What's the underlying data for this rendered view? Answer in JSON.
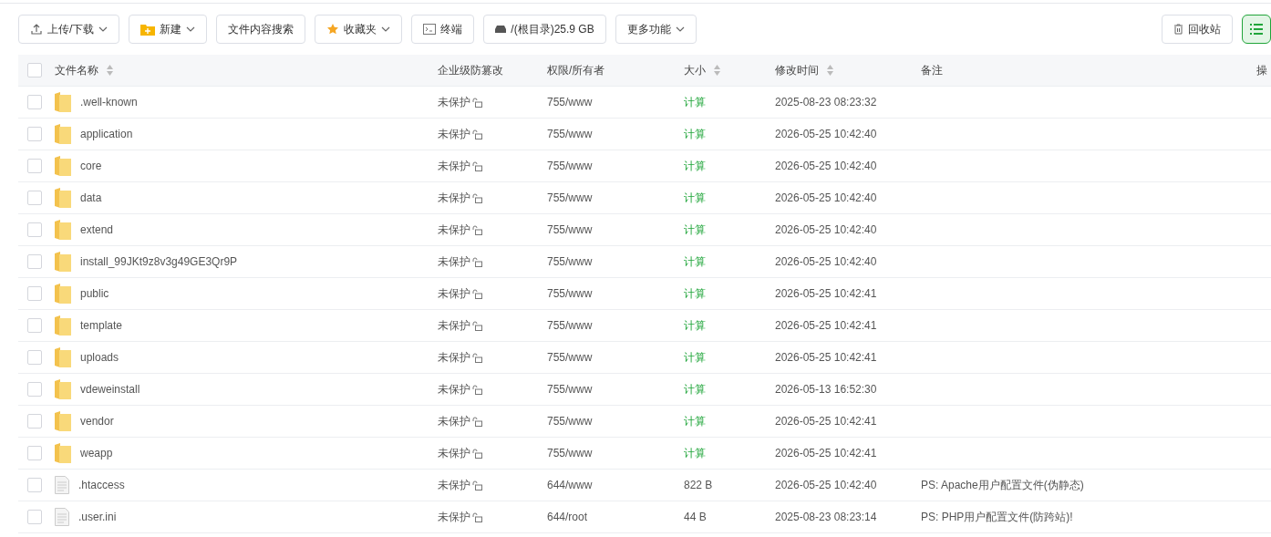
{
  "toolbar": {
    "left": [
      {
        "label": "上传/下载",
        "kind": "upload",
        "dropdown": true
      },
      {
        "label": "新建",
        "kind": "create",
        "dropdown": true
      },
      {
        "label": "文件内容搜索",
        "kind": "plain",
        "dropdown": false
      },
      {
        "label": "收藏夹",
        "kind": "favorites",
        "dropdown": true
      },
      {
        "label": "终端",
        "kind": "terminal",
        "dropdown": false
      },
      {
        "label": "/(根目录)25.9 GB",
        "kind": "disk",
        "dropdown": false
      },
      {
        "label": "更多功能",
        "kind": "plain",
        "dropdown": true
      }
    ],
    "recycle": {
      "label": "回收站"
    },
    "list_view": {
      "selected": true
    }
  },
  "table": {
    "all_checked": false,
    "columns": [
      {
        "label": "文件名称",
        "sortable": true
      },
      {
        "label": "企业级防篡改",
        "sortable": false
      },
      {
        "label": "权限/所有者",
        "sortable": false
      },
      {
        "label": "大小",
        "sortable": true
      },
      {
        "label": "修改时间",
        "sortable": true
      },
      {
        "label": "备注",
        "sortable": false
      },
      {
        "label": "操",
        "sortable": false
      }
    ],
    "rows": [
      {
        "kind": "folder",
        "checked": false,
        "name": ".well-known",
        "protect": "未保护",
        "perm": "755/www",
        "size": "计算",
        "mtime": "2025-08-23 08:23:32"
      },
      {
        "kind": "folder",
        "checked": false,
        "name": "application",
        "protect": "未保护",
        "perm": "755/www",
        "size": "计算",
        "mtime": "2026-05-25 10:42:40"
      },
      {
        "kind": "folder",
        "checked": false,
        "name": "core",
        "protect": "未保护",
        "perm": "755/www",
        "size": "计算",
        "mtime": "2026-05-25 10:42:40"
      },
      {
        "kind": "folder",
        "checked": false,
        "name": "data",
        "protect": "未保护",
        "perm": "755/www",
        "size": "计算",
        "mtime": "2026-05-25 10:42:40"
      },
      {
        "kind": "folder",
        "checked": false,
        "name": "extend",
        "protect": "未保护",
        "perm": "755/www",
        "size": "计算",
        "mtime": "2026-05-25 10:42:40"
      },
      {
        "kind": "folder",
        "checked": false,
        "name": "install_99JKt9z8v3g49GE3Qr9P",
        "protect": "未保护",
        "perm": "755/www",
        "size": "计算",
        "mtime": "2026-05-25 10:42:40"
      },
      {
        "kind": "folder",
        "checked": false,
        "name": "public",
        "protect": "未保护",
        "perm": "755/www",
        "size": "计算",
        "mtime": "2026-05-25 10:42:41"
      },
      {
        "kind": "folder",
        "checked": false,
        "name": "template",
        "protect": "未保护",
        "perm": "755/www",
        "size": "计算",
        "mtime": "2026-05-25 10:42:41"
      },
      {
        "kind": "folder",
        "checked": false,
        "name": "uploads",
        "protect": "未保护",
        "perm": "755/www",
        "size": "计算",
        "mtime": "2026-05-25 10:42:41"
      },
      {
        "kind": "folder",
        "checked": false,
        "name": "vdeweinstall",
        "protect": "未保护",
        "perm": "755/www",
        "size": "计算",
        "mtime": "2026-05-13 16:52:30"
      },
      {
        "kind": "folder",
        "checked": false,
        "name": "vendor",
        "protect": "未保护",
        "perm": "755/www",
        "size": "计算",
        "mtime": "2026-05-25 10:42:41"
      },
      {
        "kind": "folder",
        "checked": false,
        "name": "weapp",
        "protect": "未保护",
        "perm": "755/www",
        "size": "计算",
        "mtime": "2026-05-25 10:42:41"
      },
      {
        "kind": "file",
        "checked": false,
        "name": ".htaccess",
        "protect": "未保护",
        "perm": "644/www",
        "size": "822 B",
        "mtime": "2026-05-25 10:42:40",
        "note": "PS: Apache用户配置文件(伪静态)"
      },
      {
        "kind": "file",
        "checked": false,
        "name": ".user.ini",
        "protect": "未保护",
        "perm": "644/root",
        "size": "44 B",
        "mtime": "2025-08-23 08:23:14",
        "note": "PS: PHP用户配置文件(防跨站)!"
      }
    ]
  }
}
